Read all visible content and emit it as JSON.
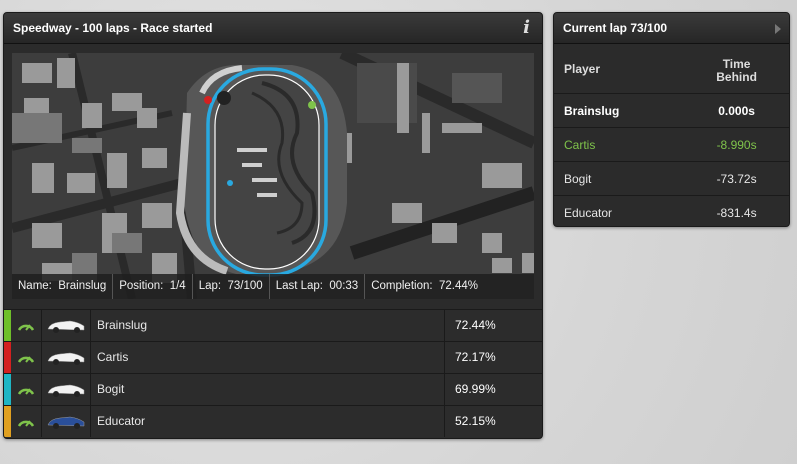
{
  "race": {
    "title": "Speedway - 100 laps - Race started",
    "info_icon": "i",
    "status": {
      "name_label": "Name:",
      "name": "Brainslug",
      "position_label": "Position:",
      "position": "1/4",
      "lap_label": "Lap:",
      "lap": "73/100",
      "last_lap_label": "Last Lap:",
      "last_lap": "00:33",
      "completion_label": "Completion:",
      "completion": "72.44%"
    },
    "racers": [
      {
        "name": "Brainslug",
        "completion": "72.44%",
        "color": "#6fbf2a"
      },
      {
        "name": "Cartis",
        "completion": "72.17%",
        "color": "#d42020"
      },
      {
        "name": "Bogit",
        "completion": "69.99%",
        "color": "#1fb5c4"
      },
      {
        "name": "Educator",
        "completion": "52.15%",
        "color": "#e0a020"
      }
    ]
  },
  "lap": {
    "title": "Current lap 73/100",
    "col_player": "Player",
    "col_time_1": "Time",
    "col_time_2": "Behind",
    "rows": [
      {
        "player": "Brainslug",
        "time": "0.000s"
      },
      {
        "player": "Cartis",
        "time": "-8.990s"
      },
      {
        "player": "Bogit",
        "time": "-73.72s"
      },
      {
        "player": "Educator",
        "time": "-831.4s"
      }
    ]
  },
  "colors": {
    "track": "#29a9e0",
    "highlight": "#7fc34b"
  }
}
